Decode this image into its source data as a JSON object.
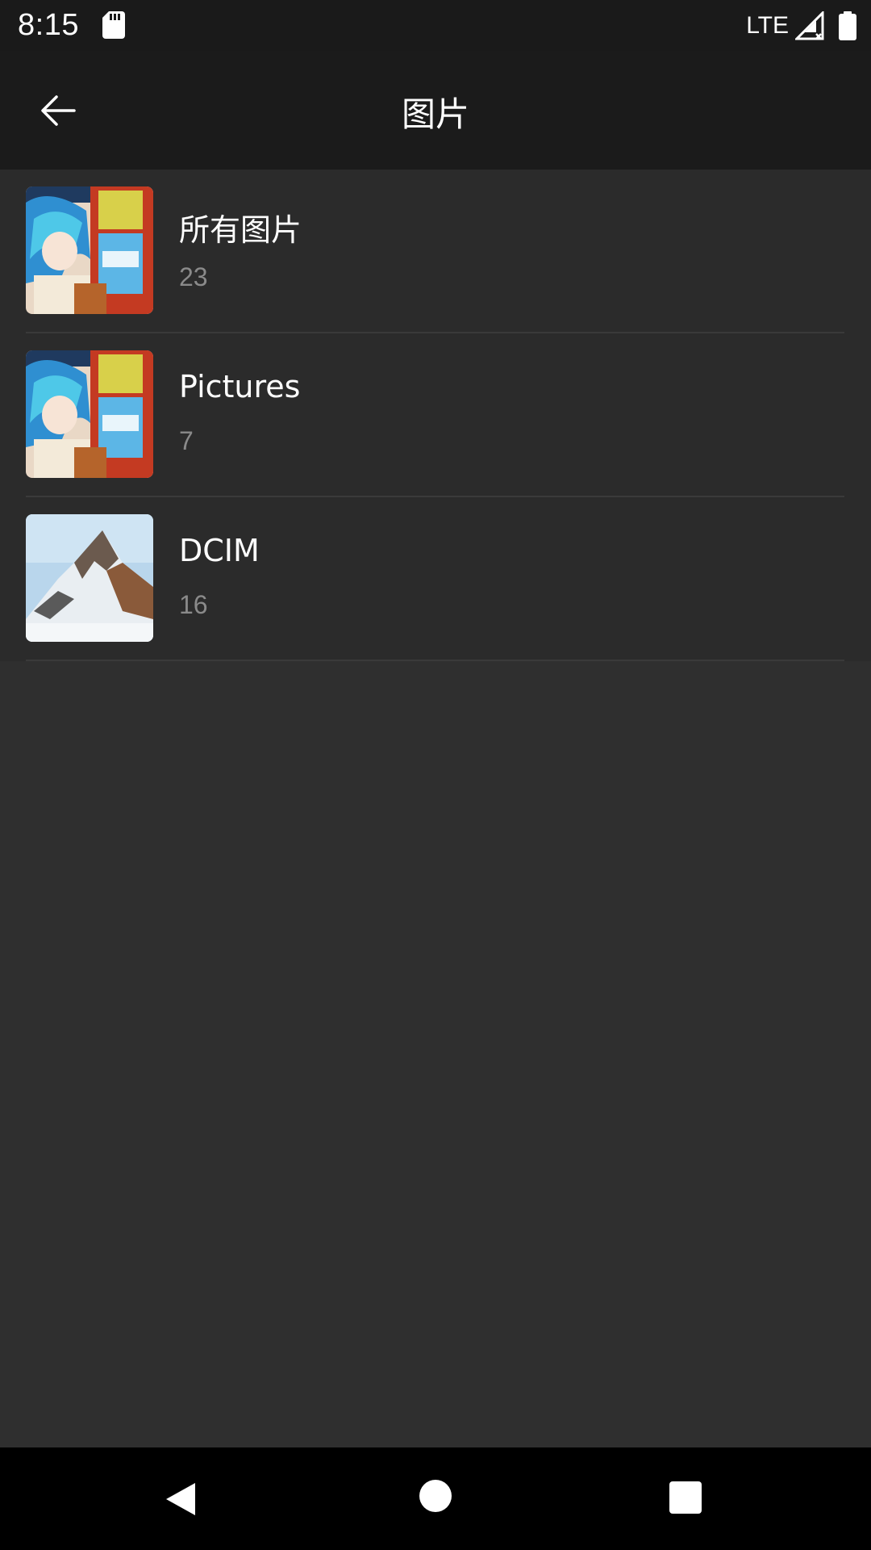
{
  "status_bar": {
    "time": "8:15",
    "network": "LTE"
  },
  "app_bar": {
    "title": "图片"
  },
  "albums": [
    {
      "name": "所有图片",
      "count": "23",
      "thumb": "anime"
    },
    {
      "name": "Pictures",
      "count": "7",
      "thumb": "anime"
    },
    {
      "name": "DCIM",
      "count": "16",
      "thumb": "mountain"
    }
  ],
  "colors": {
    "app_bar_bg": "#1b1b1b",
    "list_bg": "#2b2b2b",
    "page_bg": "#2f2f2f",
    "count_text": "#8a8a8a"
  }
}
